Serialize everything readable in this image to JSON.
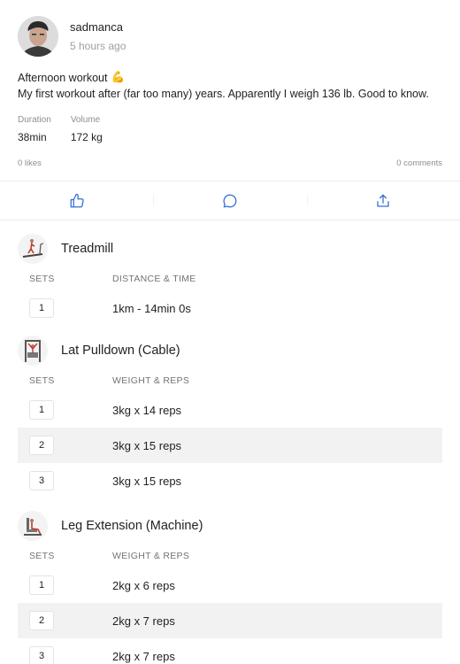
{
  "post": {
    "username": "sadmanca",
    "time_ago": "5 hours ago",
    "title": "Afternoon workout",
    "title_emoji": "💪",
    "description": "My first workout after (far too many) years. Apparently I weigh 136 lb. Good to know.",
    "stats": [
      {
        "label": "Duration",
        "value": "38min"
      },
      {
        "label": "Volume",
        "value": "172 kg"
      }
    ],
    "likes": "0 likes",
    "comments": "0 comments"
  },
  "actions": [
    {
      "icon": "thumbs-up-icon"
    },
    {
      "icon": "comment-icon"
    },
    {
      "icon": "share-icon"
    }
  ],
  "colors": {
    "accent": "#2f6fd6"
  },
  "exercises": [
    {
      "name": "Treadmill",
      "thumb_icon": "treadmill-icon",
      "col_sets": "SETS",
      "col_value": "DISTANCE & TIME",
      "sets": [
        {
          "num": "1",
          "value": "1km - 14min 0s"
        }
      ]
    },
    {
      "name": "Lat Pulldown (Cable)",
      "thumb_icon": "lat-pulldown-icon",
      "col_sets": "SETS",
      "col_value": "WEIGHT & REPS",
      "sets": [
        {
          "num": "1",
          "value": "3kg x 14 reps"
        },
        {
          "num": "2",
          "value": "3kg x 15 reps"
        },
        {
          "num": "3",
          "value": "3kg x 15 reps"
        }
      ]
    },
    {
      "name": "Leg Extension (Machine)",
      "thumb_icon": "leg-extension-icon",
      "col_sets": "SETS",
      "col_value": "WEIGHT & REPS",
      "sets": [
        {
          "num": "1",
          "value": "2kg x 6 reps"
        },
        {
          "num": "2",
          "value": "2kg x 7 reps"
        },
        {
          "num": "3",
          "value": "2kg x 7 reps"
        }
      ]
    }
  ]
}
